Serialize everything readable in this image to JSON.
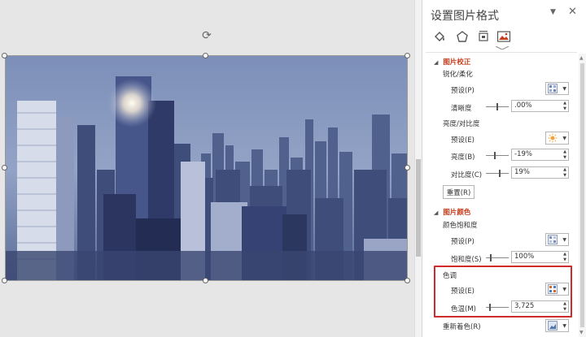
{
  "pane": {
    "title": "设置图片格式",
    "menu_icon": "chevron-down-icon",
    "close_icon": "close-icon",
    "tabs": [
      {
        "name": "fill-line",
        "icon": "paint-bucket-icon"
      },
      {
        "name": "effects",
        "icon": "pentagon-icon"
      },
      {
        "name": "size-properties",
        "icon": "size-icon"
      },
      {
        "name": "picture",
        "icon": "picture-icon",
        "active": true
      }
    ],
    "accent_color": "#c43e1c",
    "highlight_color": "#d02b2b"
  },
  "correction": {
    "header": "图片校正",
    "sharpen_label": "锐化/柔化",
    "sharpen_preset_label": "预设(P)",
    "clarity_label": "清晰度",
    "clarity_value": ".00%",
    "brightness_contrast_label": "亮度/对比度",
    "bc_preset_label": "预设(E)",
    "brightness_label": "亮度(B)",
    "brightness_value": "-19%",
    "contrast_label": "对比度(C)",
    "contrast_value": "19%",
    "reset_label": "重置(R)"
  },
  "color": {
    "header": "图片颜色",
    "saturation_group_label": "颜色饱和度",
    "saturation_preset_label": "预设(P)",
    "saturation_label": "饱和度(S)",
    "saturation_value": "100%",
    "tone_group_label": "色调",
    "tone_preset_label": "预设(E)",
    "temperature_label": "色温(M)",
    "temperature_value": "3,725",
    "recolor_label": "重新着色(R)"
  }
}
